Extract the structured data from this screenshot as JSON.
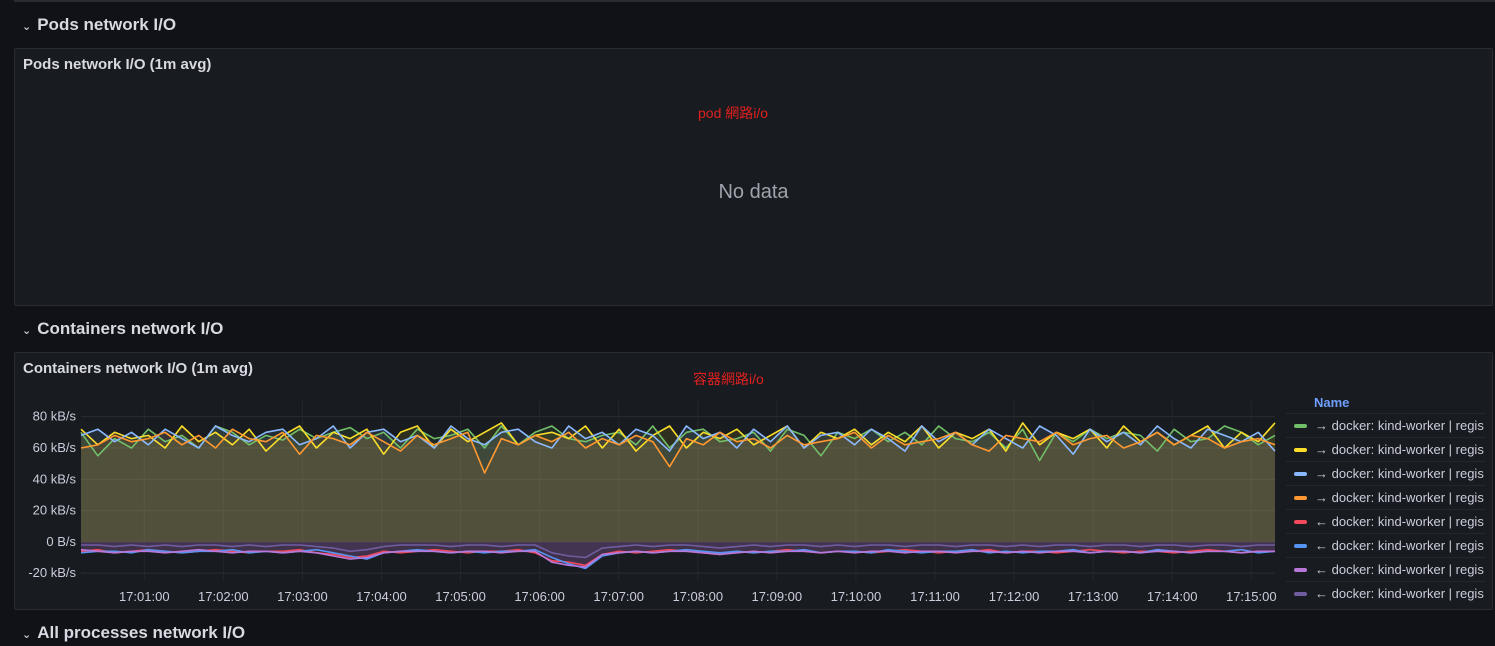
{
  "sections": {
    "pods": {
      "row_title": "Pods network I/O",
      "panel_title": "Pods network I/O (1m avg)",
      "annotation": "pod 網路i/o",
      "empty_message": "No data"
    },
    "containers": {
      "row_title": "Containers network I/O",
      "panel_title": "Containers network I/O (1m avg)",
      "annotation": "容器網路i/o"
    },
    "all_processes": {
      "row_title": "All processes network I/O"
    }
  },
  "legend": {
    "header": "Name",
    "items": [
      {
        "label": "→ docker: kind-worker | regis",
        "color": "#73bf69"
      },
      {
        "label": "→ docker: kind-worker | regis",
        "color": "#fade2a"
      },
      {
        "label": "→ docker: kind-worker | regis",
        "color": "#8ab8ff"
      },
      {
        "label": "→ docker: kind-worker | regis",
        "color": "#ff9830"
      },
      {
        "label": "← docker: kind-worker | regis",
        "color": "#f2495c"
      },
      {
        "label": "← docker: kind-worker | regis",
        "color": "#5794f2"
      },
      {
        "label": "← docker: kind-worker | regis",
        "color": "#b877d9"
      },
      {
        "label": "← docker: kind-worker | regis",
        "color": "#705da0"
      }
    ]
  },
  "chart_data": {
    "type": "line",
    "title": "Containers network I/O (1m avg)",
    "xlabel": "",
    "ylabel": "",
    "y_unit": "kB/s",
    "ylim": [
      -25,
      90
    ],
    "y_ticks": [
      {
        "value": 80,
        "label": "80 kB/s"
      },
      {
        "value": 60,
        "label": "60 kB/s"
      },
      {
        "value": 40,
        "label": "40 kB/s"
      },
      {
        "value": 20,
        "label": "20 kB/s"
      },
      {
        "value": 0,
        "label": "0 B/s"
      },
      {
        "value": -20,
        "label": "-20 kB/s"
      }
    ],
    "x_ticks": [
      "17:01:00",
      "17:02:00",
      "17:03:00",
      "17:04:00",
      "17:05:00",
      "17:06:00",
      "17:07:00",
      "17:08:00",
      "17:09:00",
      "17:10:00",
      "17:11:00",
      "17:12:00",
      "17:13:00",
      "17:14:00",
      "17:15:00"
    ],
    "x_range_minutes": [
      0.2,
      15.3
    ],
    "grid": true,
    "legend_position": "right",
    "series": [
      {
        "name": "→ docker: kind-worker | regis",
        "color": "#73bf69",
        "values": [
          70,
          55,
          66,
          60,
          72,
          64,
          68,
          60,
          74,
          70,
          62,
          68,
          65,
          72,
          66,
          70,
          73,
          66,
          70,
          60,
          72,
          66,
          68,
          72,
          60,
          74,
          62,
          70,
          74,
          66,
          64,
          68,
          70,
          62,
          74,
          60,
          70,
          72,
          64,
          66,
          70,
          58,
          72,
          68,
          55,
          70,
          66,
          72,
          64,
          70,
          62,
          74,
          66,
          64,
          70,
          60,
          72,
          52,
          70,
          64,
          72,
          66,
          70,
          68,
          58,
          72,
          64,
          66,
          74,
          70,
          62,
          68
        ]
      },
      {
        "name": "→ docker: kind-worker | regis",
        "color": "#fade2a",
        "values": [
          72,
          62,
          70,
          66,
          68,
          60,
          74,
          64,
          70,
          62,
          72,
          58,
          68,
          74,
          60,
          70,
          66,
          72,
          56,
          70,
          74,
          60,
          72,
          64,
          70,
          76,
          62,
          68,
          70,
          66,
          74,
          60,
          72,
          58,
          68,
          74,
          60,
          70,
          66,
          72,
          62,
          68,
          74,
          60,
          70,
          66,
          72,
          62,
          70,
          64,
          74,
          60,
          70,
          66,
          72,
          58,
          76,
          62,
          70,
          66,
          72,
          60,
          74,
          64,
          70,
          62,
          68,
          74,
          60,
          70,
          64,
          76
        ]
      },
      {
        "name": "→ docker: kind-worker | regis",
        "color": "#8ab8ff",
        "values": [
          68,
          72,
          64,
          70,
          62,
          72,
          66,
          60,
          74,
          68,
          64,
          70,
          72,
          62,
          66,
          74,
          60,
          70,
          72,
          64,
          68,
          60,
          74,
          66,
          62,
          70,
          72,
          64,
          60,
          74,
          66,
          70,
          62,
          72,
          68,
          58,
          74,
          66,
          70,
          60,
          72,
          64,
          74,
          60,
          68,
          70,
          62,
          72,
          66,
          58,
          74,
          64,
          70,
          62,
          72,
          66,
          60,
          74,
          68,
          56,
          72,
          64,
          70,
          62,
          74,
          66,
          60,
          72,
          68,
          64,
          70,
          58
        ]
      },
      {
        "name": "→ docker: kind-worker | regis",
        "color": "#ff9830",
        "values": [
          60,
          62,
          68,
          64,
          66,
          70,
          62,
          68,
          60,
          72,
          66,
          64,
          70,
          56,
          68,
          66,
          62,
          70,
          64,
          58,
          68,
          62,
          66,
          70,
          44,
          66,
          62,
          68,
          64,
          70,
          60,
          66,
          62,
          68,
          64,
          48,
          66,
          62,
          70,
          64,
          66,
          60,
          68,
          62,
          64,
          66,
          70,
          60,
          68,
          62,
          64,
          66,
          70,
          62,
          58,
          68,
          66,
          64,
          70,
          62,
          66,
          68,
          60,
          64,
          70,
          62,
          68,
          66,
          60,
          64,
          66,
          62
        ]
      },
      {
        "name": "← docker: kind-worker | regis",
        "color": "#f2495c",
        "values": [
          -6,
          -5,
          -7,
          -6,
          -5,
          -6,
          -7,
          -6,
          -5,
          -6,
          -7,
          -6,
          -6,
          -5,
          -7,
          -8,
          -10,
          -9,
          -6,
          -7,
          -6,
          -5,
          -6,
          -7,
          -6,
          -6,
          -5,
          -7,
          -12,
          -13,
          -15,
          -8,
          -6,
          -7,
          -6,
          -5,
          -6,
          -7,
          -8,
          -6,
          -7,
          -6,
          -5,
          -6,
          -7,
          -6,
          -6,
          -7,
          -6,
          -5,
          -6,
          -7,
          -6,
          -6,
          -5,
          -7,
          -6,
          -6,
          -7,
          -6,
          -5,
          -6,
          -7,
          -6,
          -6,
          -7,
          -6,
          -5,
          -6,
          -7,
          -6,
          -6
        ]
      },
      {
        "name": "← docker: kind-worker | regis",
        "color": "#5794f2",
        "values": [
          -7,
          -6,
          -6,
          -7,
          -5,
          -6,
          -7,
          -6,
          -6,
          -5,
          -7,
          -6,
          -7,
          -6,
          -5,
          -7,
          -9,
          -11,
          -7,
          -6,
          -5,
          -6,
          -7,
          -6,
          -7,
          -6,
          -6,
          -5,
          -10,
          -14,
          -17,
          -9,
          -7,
          -6,
          -7,
          -6,
          -5,
          -6,
          -7,
          -6,
          -7,
          -6,
          -6,
          -5,
          -7,
          -6,
          -6,
          -7,
          -5,
          -6,
          -7,
          -6,
          -6,
          -5,
          -7,
          -6,
          -7,
          -6,
          -6,
          -5,
          -7,
          -6,
          -6,
          -7,
          -5,
          -6,
          -7,
          -6,
          -6,
          -5,
          -7,
          -6
        ]
      },
      {
        "name": "← docker: kind-worker | regis",
        "color": "#b877d9",
        "values": [
          -5,
          -6,
          -7,
          -6,
          -6,
          -7,
          -6,
          -5,
          -6,
          -7,
          -6,
          -6,
          -7,
          -6,
          -7,
          -9,
          -11,
          -10,
          -7,
          -6,
          -6,
          -6,
          -7,
          -6,
          -6,
          -7,
          -6,
          -6,
          -13,
          -15,
          -16,
          -8,
          -7,
          -6,
          -7,
          -6,
          -6,
          -7,
          -8,
          -7,
          -6,
          -7,
          -6,
          -6,
          -7,
          -6,
          -7,
          -6,
          -6,
          -7,
          -6,
          -6,
          -7,
          -6,
          -6,
          -7,
          -6,
          -7,
          -6,
          -6,
          -7,
          -6,
          -6,
          -7,
          -6,
          -6,
          -7,
          -6,
          -6,
          -7,
          -6,
          -6
        ]
      },
      {
        "name": "← docker: kind-worker | regis",
        "color": "#705da0",
        "values": [
          -2,
          -2,
          -3,
          -2,
          -3,
          -2,
          -3,
          -2,
          -2,
          -3,
          -2,
          -3,
          -2,
          -2,
          -3,
          -4,
          -6,
          -5,
          -3,
          -2,
          -2,
          -2,
          -3,
          -2,
          -2,
          -3,
          -2,
          -2,
          -7,
          -9,
          -10,
          -4,
          -3,
          -2,
          -3,
          -2,
          -2,
          -3,
          -4,
          -3,
          -2,
          -3,
          -2,
          -2,
          -3,
          -2,
          -3,
          -2,
          -2,
          -3,
          -2,
          -2,
          -3,
          -2,
          -2,
          -3,
          -2,
          -3,
          -2,
          -2,
          -3,
          -2,
          -2,
          -3,
          -2,
          -2,
          -3,
          -2,
          -2,
          -3,
          -2,
          -2
        ]
      }
    ]
  }
}
